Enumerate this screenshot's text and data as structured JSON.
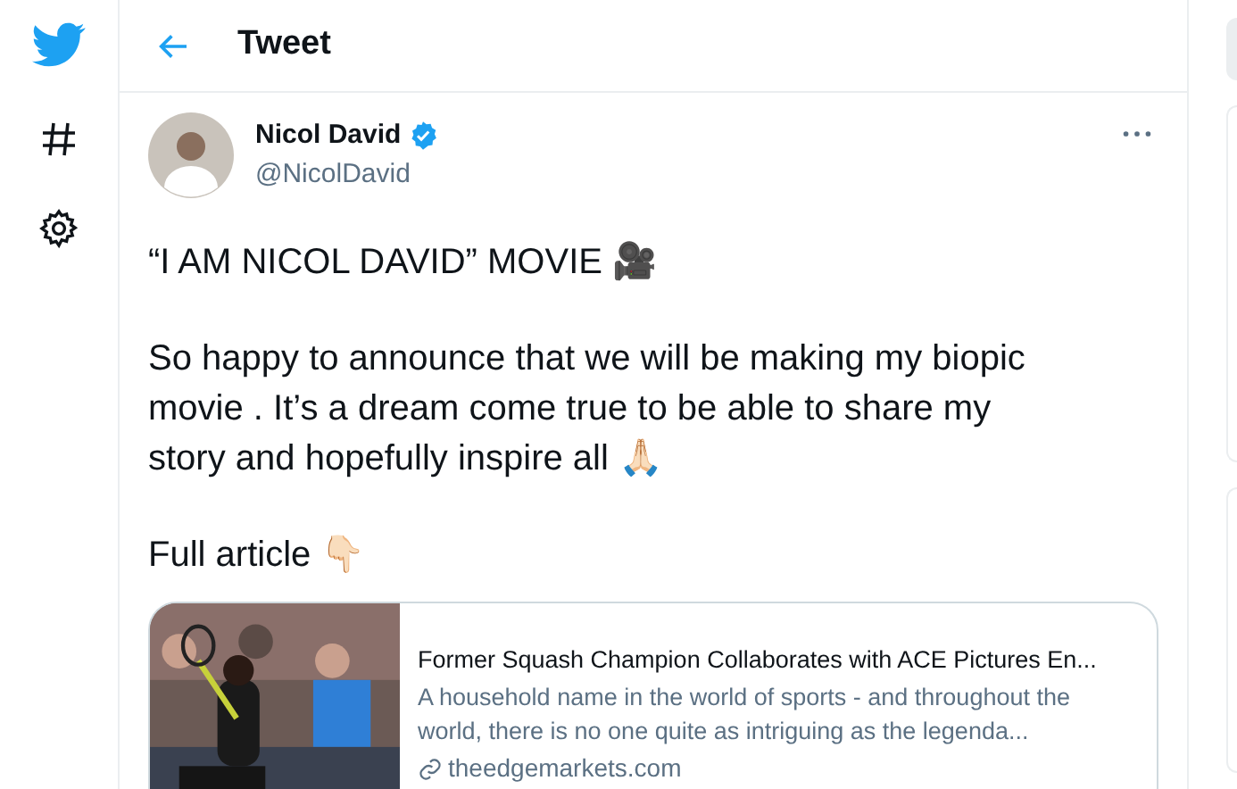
{
  "header": {
    "title": "Tweet"
  },
  "tweet": {
    "author": {
      "name": "Nicol David",
      "handle": "@NicolDavid",
      "verified": true
    },
    "paragraphs": [
      "“I AM NICOL DAVID” MOVIE 🎥",
      "So happy to announce that we will be making my biopic movie . It’s a dream come true to be able to share my story and hopefully inspire all 🙏🏻",
      "Full article 👇🏻"
    ],
    "link_card": {
      "title": "Former Squash Champion Collaborates with ACE Pictures En...",
      "description": "A household name in the world of sports - and throughout the world, there is no one quite as intriguing as the legenda...",
      "domain": "theedgemarkets.com"
    }
  }
}
